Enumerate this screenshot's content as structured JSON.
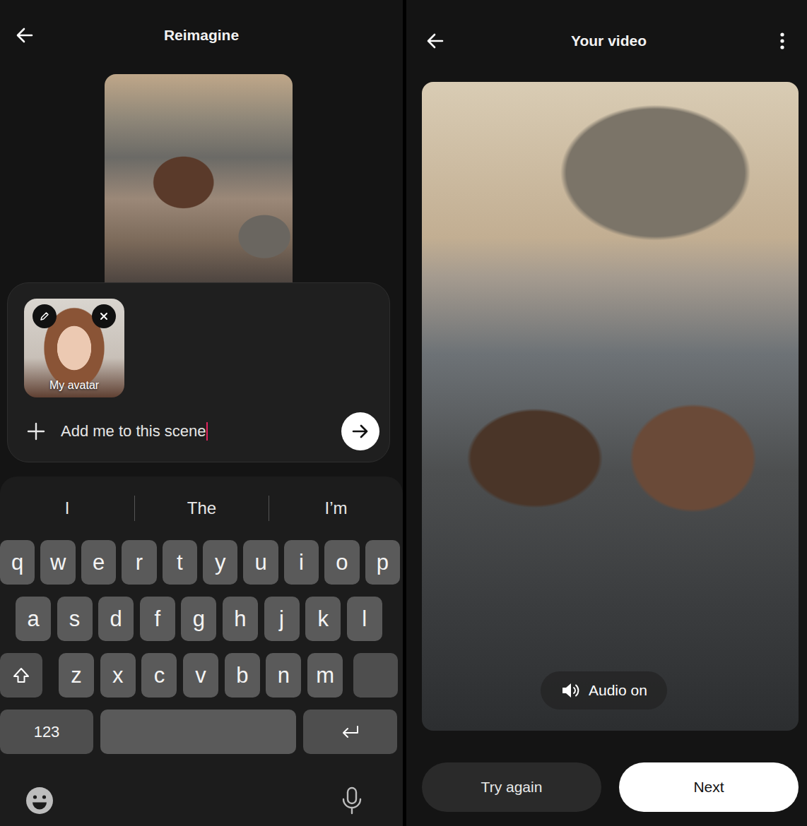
{
  "reimagine": {
    "title": "Reimagine",
    "avatar": {
      "label": "My avatar"
    },
    "prompt": {
      "value": "Add me to this scene",
      "focused": true
    },
    "keyboard": {
      "suggestions": [
        "I",
        "The",
        "I’m"
      ],
      "rows": [
        [
          "q",
          "w",
          "e",
          "r",
          "t",
          "y",
          "u",
          "i",
          "o",
          "p"
        ],
        [
          "a",
          "s",
          "d",
          "f",
          "g",
          "h",
          "j",
          "k",
          "l"
        ],
        [
          "z",
          "x",
          "c",
          "v",
          "b",
          "n",
          "m"
        ]
      ],
      "numbers_key": "123"
    }
  },
  "video": {
    "title": "Your video",
    "audio": {
      "label": "Audio on",
      "on": true
    },
    "buttons": [
      {
        "label": "Try again",
        "kind": "secondary"
      },
      {
        "label": "Next",
        "kind": "primary"
      }
    ]
  }
}
